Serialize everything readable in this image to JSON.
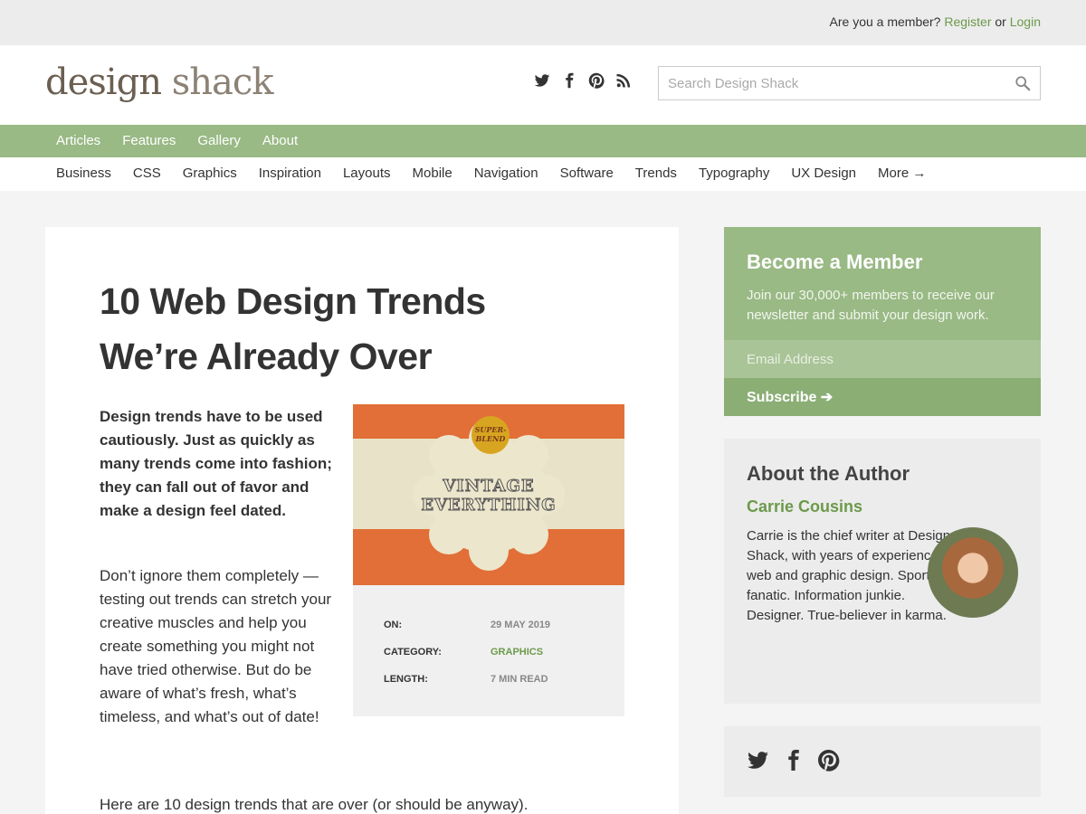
{
  "topbar": {
    "prefix": "Are you a member?",
    "register": "Register",
    "or": "or",
    "login": "Login"
  },
  "logo": {
    "word1": "design",
    "word2": "shack"
  },
  "search": {
    "placeholder": "Search Design Shack"
  },
  "mainnav": [
    "Articles",
    "Features",
    "Gallery",
    "About"
  ],
  "subnav": [
    "Business",
    "CSS",
    "Graphics",
    "Inspiration",
    "Layouts",
    "Mobile",
    "Navigation",
    "Software",
    "Trends",
    "Typography",
    "UX Design",
    "More →"
  ],
  "article": {
    "title": "10 Web Design Trends We’re Already Over",
    "lead": "Design trends have to be used cautiously. Just as quickly as many trends come into fashion; they can fall out of favor and make a design feel dated.",
    "body": "Don’t ignore them completely — testing out trends can stretch your creative muscles and help you create something you might not have tried otherwise. But do be aware of what’s fresh, what’s timeless, and what’s out of date!",
    "body2": "Here are 10 design trends that are over (or should be anyway).",
    "image": {
      "badge1": "SUPER-",
      "badge2": "BLEND",
      "line1": "VINTAGE",
      "line2": "EVERYTHING"
    },
    "meta": [
      {
        "label": "ON:",
        "value": "29 MAY 2019"
      },
      {
        "label": "CATEGORY:",
        "value": "GRAPHICS"
      },
      {
        "label": "LENGTH:",
        "value": "7 MIN READ"
      }
    ]
  },
  "member": {
    "title": "Become a Member",
    "text": "Join our 30,000+ members to receive our newsletter and submit your design work.",
    "email_placeholder": "Email Address",
    "subscribe": "Subscribe ➔"
  },
  "author": {
    "heading": "About the Author",
    "name": "Carrie Cousins",
    "bio": "Carrie is the chief writer at Design Shack, with years of experience in web and graphic design. Sports fanatic. Information junkie. Designer. True-believer in karma."
  },
  "colors": {
    "accent": "#99b985",
    "link": "#6c9a4a",
    "image_orange": "#e26f37"
  },
  "icons": [
    "twitter-icon",
    "facebook-icon",
    "pinterest-icon",
    "rss-icon",
    "search-icon"
  ]
}
